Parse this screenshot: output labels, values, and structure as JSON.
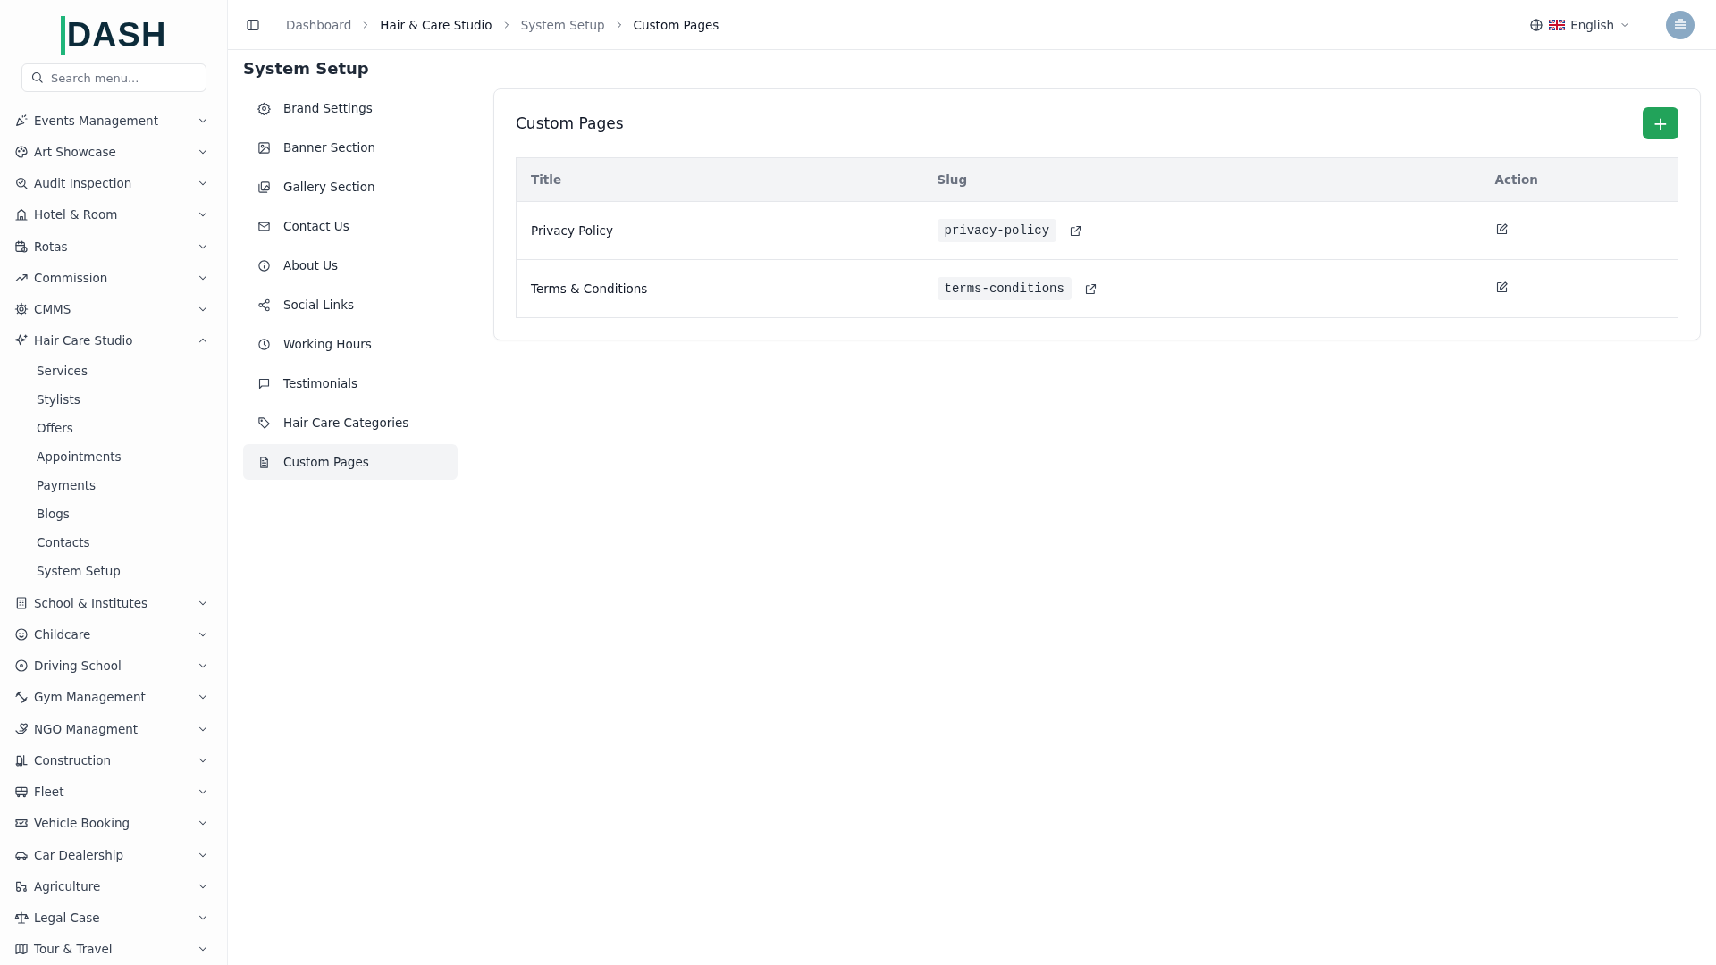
{
  "logo": {
    "text": "DASH"
  },
  "search": {
    "placeholder": "Search menu..."
  },
  "sidebar": {
    "items": [
      {
        "label": "Events Management",
        "expanded": false
      },
      {
        "label": "Art Showcase",
        "expanded": false
      },
      {
        "label": "Audit Inspection",
        "expanded": false
      },
      {
        "label": "Hotel & Room",
        "expanded": false
      },
      {
        "label": "Rotas",
        "expanded": false
      },
      {
        "label": "Commission",
        "expanded": false
      },
      {
        "label": "CMMS",
        "expanded": false
      },
      {
        "label": "Hair Care Studio",
        "expanded": true,
        "children": [
          {
            "label": "Services"
          },
          {
            "label": "Stylists"
          },
          {
            "label": "Offers"
          },
          {
            "label": "Appointments"
          },
          {
            "label": "Payments"
          },
          {
            "label": "Blogs"
          },
          {
            "label": "Contacts"
          },
          {
            "label": "System Setup"
          }
        ]
      },
      {
        "label": "School & Institutes",
        "expanded": false
      },
      {
        "label": "Childcare",
        "expanded": false
      },
      {
        "label": "Driving School",
        "expanded": false
      },
      {
        "label": "Gym Management",
        "expanded": false
      },
      {
        "label": "NGO Managment",
        "expanded": false
      },
      {
        "label": "Construction",
        "expanded": false
      },
      {
        "label": "Fleet",
        "expanded": false
      },
      {
        "label": "Vehicle Booking",
        "expanded": false
      },
      {
        "label": "Car Dealership",
        "expanded": false
      },
      {
        "label": "Agriculture",
        "expanded": false
      },
      {
        "label": "Legal Case",
        "expanded": false
      },
      {
        "label": "Tour & Travel",
        "expanded": false
      }
    ]
  },
  "breadcrumb": [
    {
      "label": "Dashboard",
      "strong": false
    },
    {
      "label": "Hair & Care Studio",
      "strong": true
    },
    {
      "label": "System Setup",
      "strong": false
    },
    {
      "label": "Custom Pages",
      "strong": true
    }
  ],
  "language": {
    "label": "English"
  },
  "page_title": "System Setup",
  "settings_nav": [
    {
      "label": "Brand Settings",
      "selected": false
    },
    {
      "label": "Banner Section",
      "selected": false
    },
    {
      "label": "Gallery Section",
      "selected": false
    },
    {
      "label": "Contact Us",
      "selected": false
    },
    {
      "label": "About Us",
      "selected": false
    },
    {
      "label": "Social Links",
      "selected": false
    },
    {
      "label": "Working Hours",
      "selected": false
    },
    {
      "label": "Testimonials",
      "selected": false
    },
    {
      "label": "Hair Care Categories",
      "selected": false
    },
    {
      "label": "Custom Pages",
      "selected": true
    }
  ],
  "card": {
    "title": "Custom Pages",
    "add_button": "+"
  },
  "table": {
    "columns": [
      "Title",
      "Slug",
      "Action"
    ],
    "rows": [
      {
        "title": "Privacy Policy",
        "slug": "privacy-policy"
      },
      {
        "title": "Terms & Conditions",
        "slug": "terms-conditions"
      }
    ]
  }
}
